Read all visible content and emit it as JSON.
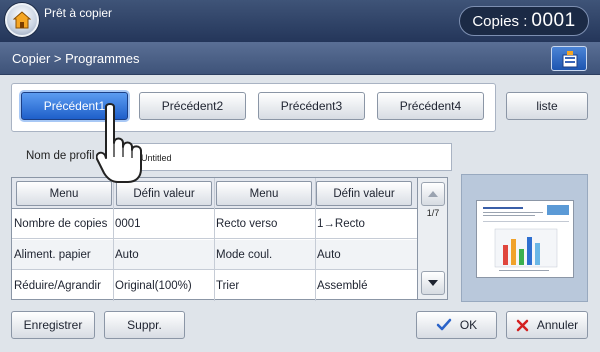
{
  "status": {
    "text": "Prêt à copier",
    "copies_label": "Copies :",
    "copies_value": "0001"
  },
  "header": {
    "breadcrumb": "Copier > Programmes"
  },
  "presets": [
    "Précédent1",
    "Précédent2",
    "Précédent3",
    "Précédent4"
  ],
  "list_button": "liste",
  "name_field": {
    "label": "Nom de profil",
    "value": "Untitled"
  },
  "table": {
    "headers": [
      "Menu",
      "Défin valeur",
      "Menu",
      "Défin valeur"
    ],
    "rows": [
      [
        "Nombre de copies",
        "0001",
        "Recto verso",
        "1→Recto"
      ],
      [
        "Aliment. papier",
        "Auto",
        "Mode coul.",
        "Auto"
      ],
      [
        "Réduire/Agrandir",
        "Original(100%)",
        "Trier",
        "Assemblé"
      ]
    ],
    "page_indicator": "1/7"
  },
  "buttons": {
    "save": "Enregistrer",
    "delete": "Suppr.",
    "ok": "OK",
    "cancel": "Annuler"
  },
  "icons": [
    "home-icon",
    "program-settings-icon",
    "scroll-up-icon",
    "scroll-down-icon",
    "check-icon",
    "close-icon",
    "hand-cursor-icon"
  ],
  "colors": {
    "topbar": "#24365a",
    "active_preset": "#1e5fca",
    "ok_check": "#2a63c9",
    "cancel_x": "#d42020"
  }
}
